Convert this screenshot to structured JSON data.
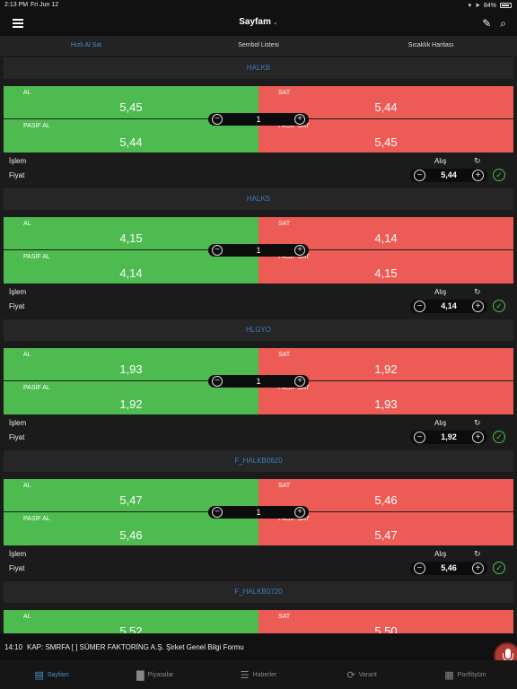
{
  "status_bar": {
    "time": "2:13 PM",
    "date": "Fri Jun 12",
    "battery": "84%"
  },
  "navbar": {
    "title": "Sayfam"
  },
  "tabs": [
    {
      "label": "Hızlı Al Sat"
    },
    {
      "label": "Sembol Listesi"
    },
    {
      "label": "Sıcaklık Haritası"
    }
  ],
  "labels": {
    "al": "AL",
    "sat": "SAT",
    "pasif_al": "PASİF AL",
    "pasif_sat": "PASİF SAT",
    "islem": "İşlem",
    "fiyat": "Fiyat",
    "alis": "Alış"
  },
  "cards": [
    {
      "symbol": "HALKB",
      "al": "5,45",
      "sat": "5,44",
      "pasif_al": "5,44",
      "pasif_sat": "5,45",
      "qty": "1",
      "price": "5,44"
    },
    {
      "symbol": "HALKS",
      "al": "4,15",
      "sat": "4,14",
      "pasif_al": "4,14",
      "pasif_sat": "4,15",
      "qty": "1",
      "price": "4,14"
    },
    {
      "symbol": "HLGYO",
      "al": "1,93",
      "sat": "1,92",
      "pasif_al": "1,92",
      "pasif_sat": "1,93",
      "qty": "1",
      "price": "1,92"
    },
    {
      "symbol": "F_HALKB0620",
      "al": "5,47",
      "sat": "5,46",
      "pasif_al": "5,46",
      "pasif_sat": "5,47",
      "qty": "1",
      "price": "5,46"
    },
    {
      "symbol": "F_HALKB0720",
      "al": "5,52",
      "sat": "5,50"
    }
  ],
  "ticker": {
    "time": "14:10",
    "text": "KAP: SMRFA  [ ] SÜMER FAKTORİNG A.Ş.  Şirket Genel Bilgi Formu"
  },
  "bottom_nav": [
    {
      "label": "Sayfam",
      "icon": "document-icon"
    },
    {
      "label": "Piyasalar",
      "icon": "bar-chart-icon"
    },
    {
      "label": "Haberler",
      "icon": "news-icon"
    },
    {
      "label": "Varant",
      "icon": "cycle-icon"
    },
    {
      "label": "Portföyüm",
      "icon": "building-icon"
    }
  ],
  "colors": {
    "buy": "#4dbb4f",
    "sell": "#ec5b55",
    "accent": "#4a90c8",
    "background": "#1b1b1b"
  }
}
